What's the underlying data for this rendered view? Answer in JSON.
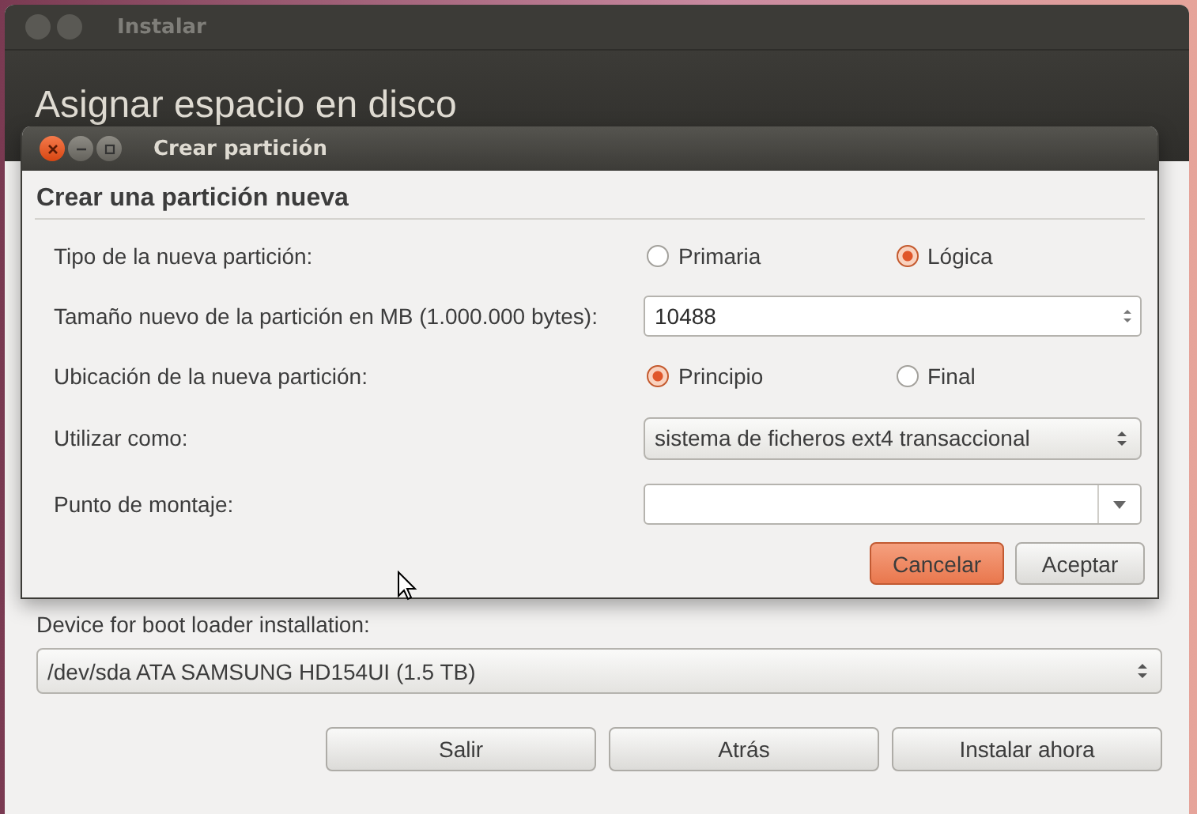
{
  "installer": {
    "title": "Instalar",
    "heading": "Asignar espacio en disco",
    "boot_loader": {
      "label": "Device for boot loader installation:",
      "value": "/dev/sda ATA SAMSUNG HD154UI (1.5 TB)"
    },
    "buttons": [
      "Salir",
      "Atrás",
      "Instalar ahora"
    ]
  },
  "dialog": {
    "title": "Crear partición",
    "heading": "Crear una partición nueva",
    "rows": [
      {
        "kind": "radio",
        "label": "Tipo de la nueva partición:",
        "options": [
          {
            "label": "Primaria",
            "selected": false
          },
          {
            "label": "Lógica",
            "selected": true
          }
        ]
      },
      {
        "kind": "spin",
        "label": "Tamaño nuevo de la partición en MB (1.000.000 bytes):",
        "value": "10488"
      },
      {
        "kind": "radio",
        "label": "Ubicación de la nueva partición:",
        "options": [
          {
            "label": "Principio",
            "selected": true
          },
          {
            "label": "Final",
            "selected": false
          }
        ]
      },
      {
        "kind": "combo",
        "label": "Utilizar como:",
        "value": "sistema de ficheros ext4 transaccional"
      },
      {
        "kind": "entry",
        "label": "Punto de montaje:"
      }
    ],
    "buttons": [
      {
        "label": "Cancelar",
        "default": true
      },
      {
        "label": "Aceptar",
        "default": false
      }
    ]
  }
}
